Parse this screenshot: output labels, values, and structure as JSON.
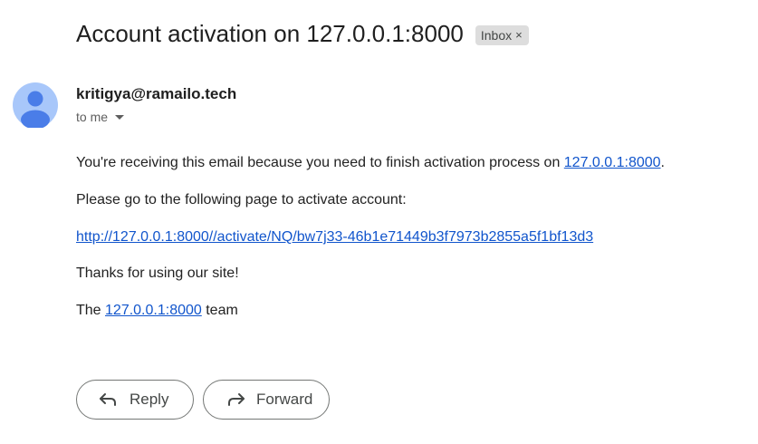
{
  "email": {
    "subject": "Account activation on 127.0.0.1:8000",
    "label": "Inbox",
    "label_remove_glyph": "×",
    "sender": "kritigya@ramailo.tech",
    "recipient": "to me"
  },
  "body": {
    "line1_prefix": "You're receiving this email because you need to finish activation process on ",
    "line1_link": "127.0.0.1:8000",
    "line1_suffix": ".",
    "line2": "Please go to the following page to activate account:",
    "activation_link": "http://127.0.0.1:8000//activate/NQ/bw7j33-46b1e71449b3f7973b2855a5f1bf13d3",
    "line4": "Thanks for using our site!",
    "line5_prefix": "The ",
    "line5_link": "127.0.0.1:8000",
    "line5_suffix": " team"
  },
  "actions": {
    "reply_label": "Reply",
    "forward_label": "Forward"
  },
  "colors": {
    "link": "#1155cc",
    "avatar_bg": "#a8c7fa",
    "avatar_fg": "#4a7de8",
    "chip_bg": "#dddddd"
  },
  "icons": {
    "avatar": "person-icon",
    "reply": "reply-arrow-icon",
    "forward": "forward-arrow-icon",
    "caret": "caret-down-icon"
  }
}
